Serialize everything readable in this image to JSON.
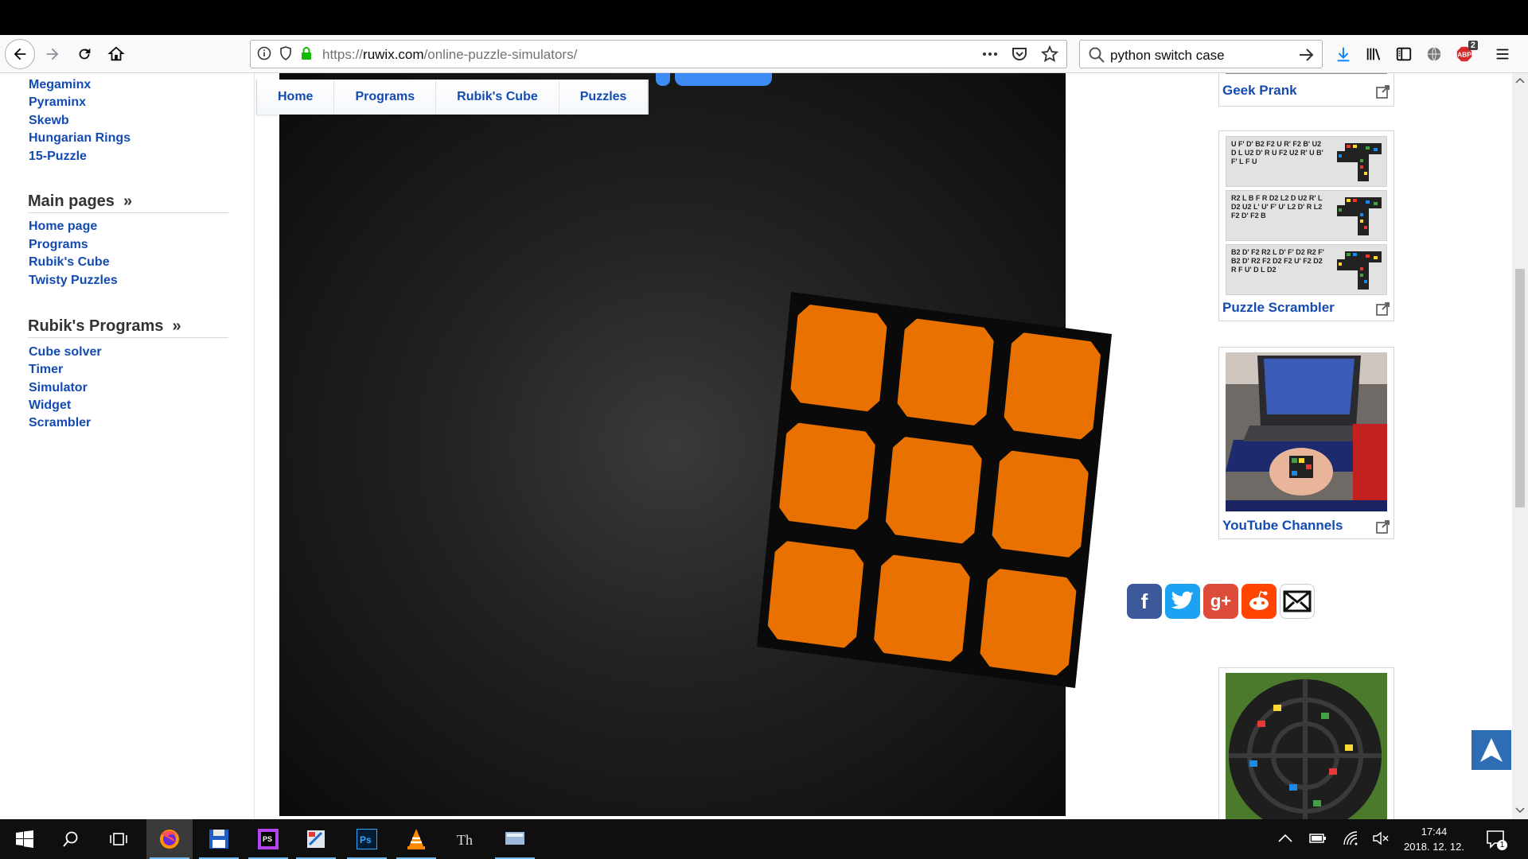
{
  "browser": {
    "url_prefix": "https://",
    "url_host": "ruwix.com",
    "url_path": "/online-puzzle-simulators/",
    "search_query": "python switch case",
    "addon_badge": "2"
  },
  "sidebar": {
    "puzzle_links": [
      "Megaminx",
      "Pyraminx",
      "Skewb",
      "Hungarian Rings",
      "15-Puzzle"
    ],
    "main_pages_heading": "Main pages",
    "main_pages_links": [
      "Home page",
      "Programs",
      "Rubik's Cube",
      "Twisty Puzzles"
    ],
    "programs_heading": "Rubik's Programs",
    "programs_links": [
      "Cube solver",
      "Timer",
      "Simulator",
      "Widget",
      "Scrambler"
    ],
    "heading_arrow": "»"
  },
  "nav_tabs": [
    "Home",
    "Programs",
    "Rubik's Cube",
    "Puzzles"
  ],
  "cube": {
    "face_color": "#e87100",
    "sticker_count": 9
  },
  "right_column": {
    "geek_prank_label": "Geek Prank",
    "puzzle_scrambler_label": "Puzzle Scrambler",
    "scrambles": [
      "U F' D' B2 F2 U R' F2 B' U2 D L U2 D' R U F2 U2 R' U B' F' L F U",
      "R2 L B F R D2 L2 D U2 R' L D2 U2 L' U' F' U' L2 D' R L2 F2 D' F2 B",
      "B2 D' F2 R2 L D' F' D2 R2 F' B2 D' R2 F2 D2 F2 U' F2 D2 R F U' D L D2"
    ],
    "youtube_label": "YouTube Channels"
  },
  "share_icons": [
    "facebook-icon",
    "twitter-icon",
    "google-plus-icon",
    "reddit-icon",
    "email-icon"
  ],
  "taskbar": {
    "time": "17:44",
    "date": "2018. 12. 12.",
    "notification_count": "1"
  }
}
